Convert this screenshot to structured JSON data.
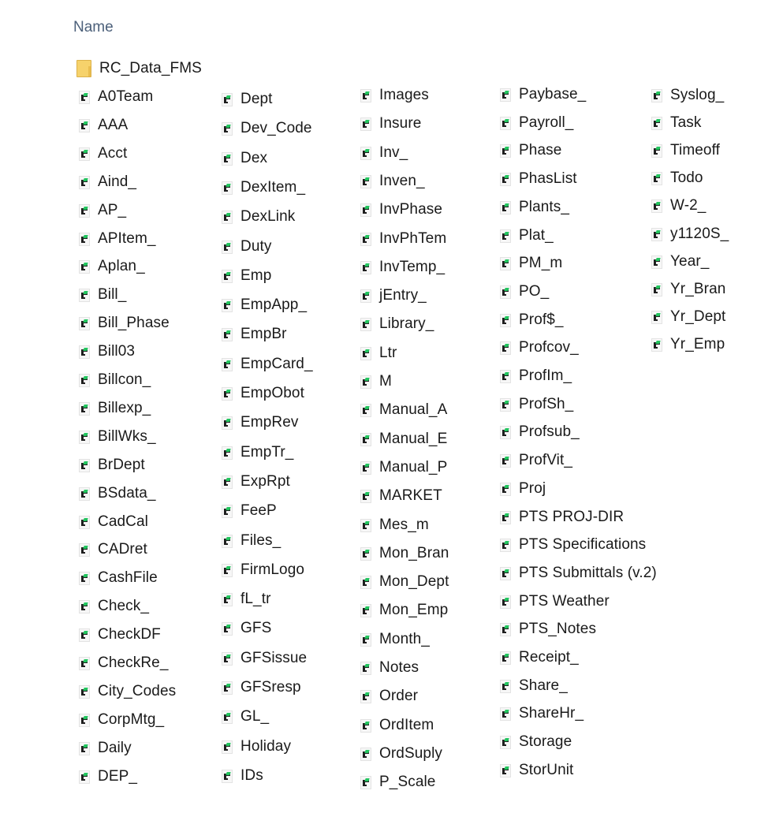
{
  "header": {
    "name_column": "Name"
  },
  "folder": {
    "name": "RC_Data_FMS",
    "icon": "folder-icon"
  },
  "file_icon": "database-file-icon",
  "columns": [
    [
      "A0Team",
      "AAA",
      "Acct",
      "Aind_",
      "AP_",
      "APItem_",
      "Aplan_",
      "Bill_",
      "Bill_Phase",
      "Bill03",
      "Billcon_",
      "Billexp_",
      "BillWks_",
      "BrDept",
      "BSdata_",
      "CadCal",
      "CADret",
      "CashFile",
      "Check_",
      "CheckDF",
      "CheckRe_",
      "City_Codes",
      "CorpMtg_",
      "Daily",
      "DEP_"
    ],
    [
      "Dept",
      "Dev_Code",
      "Dex",
      "DexItem_",
      "DexLink",
      "Duty",
      "Emp",
      "EmpApp_",
      "EmpBr",
      "EmpCard_",
      "EmpObot",
      "EmpRev",
      "EmpTr_",
      "ExpRpt",
      "FeeP",
      "Files_",
      "FirmLogo",
      "fL_tr",
      "GFS",
      "GFSissue",
      "GFSresp",
      "GL_",
      "Holiday",
      "IDs"
    ],
    [
      "Images",
      "Insure",
      "Inv_",
      "Inven_",
      "InvPhase",
      "InvPhTem",
      "InvTemp_",
      "jEntry_",
      "Library_",
      "Ltr",
      "M",
      "Manual_A",
      "Manual_E",
      "Manual_P",
      "MARKET",
      "Mes_m",
      "Mon_Bran",
      "Mon_Dept",
      "Mon_Emp",
      "Month_",
      "Notes",
      "Order",
      "OrdItem",
      "OrdSuply",
      "P_Scale"
    ],
    [
      "Paybase_",
      "Payroll_",
      "Phase",
      "PhasList",
      "Plants_",
      "Plat_",
      "PM_m",
      "PO_",
      "Prof$_",
      "Profcov_",
      "ProfIm_",
      "ProfSh_",
      "Profsub_",
      "ProfVit_",
      "Proj",
      "PTS PROJ-DIR",
      "PTS Specifications",
      "PTS Submittals (v.2)",
      "PTS Weather",
      "PTS_Notes",
      "Receipt_",
      "Share_",
      "ShareHr_",
      "Storage",
      "StorUnit"
    ],
    [
      "Syslog_",
      "Task",
      "Timeoff",
      "Todo",
      "W-2_",
      "y1120S_",
      "Year_",
      "Yr_Bran",
      "Yr_Dept",
      "Yr_Emp"
    ]
  ]
}
